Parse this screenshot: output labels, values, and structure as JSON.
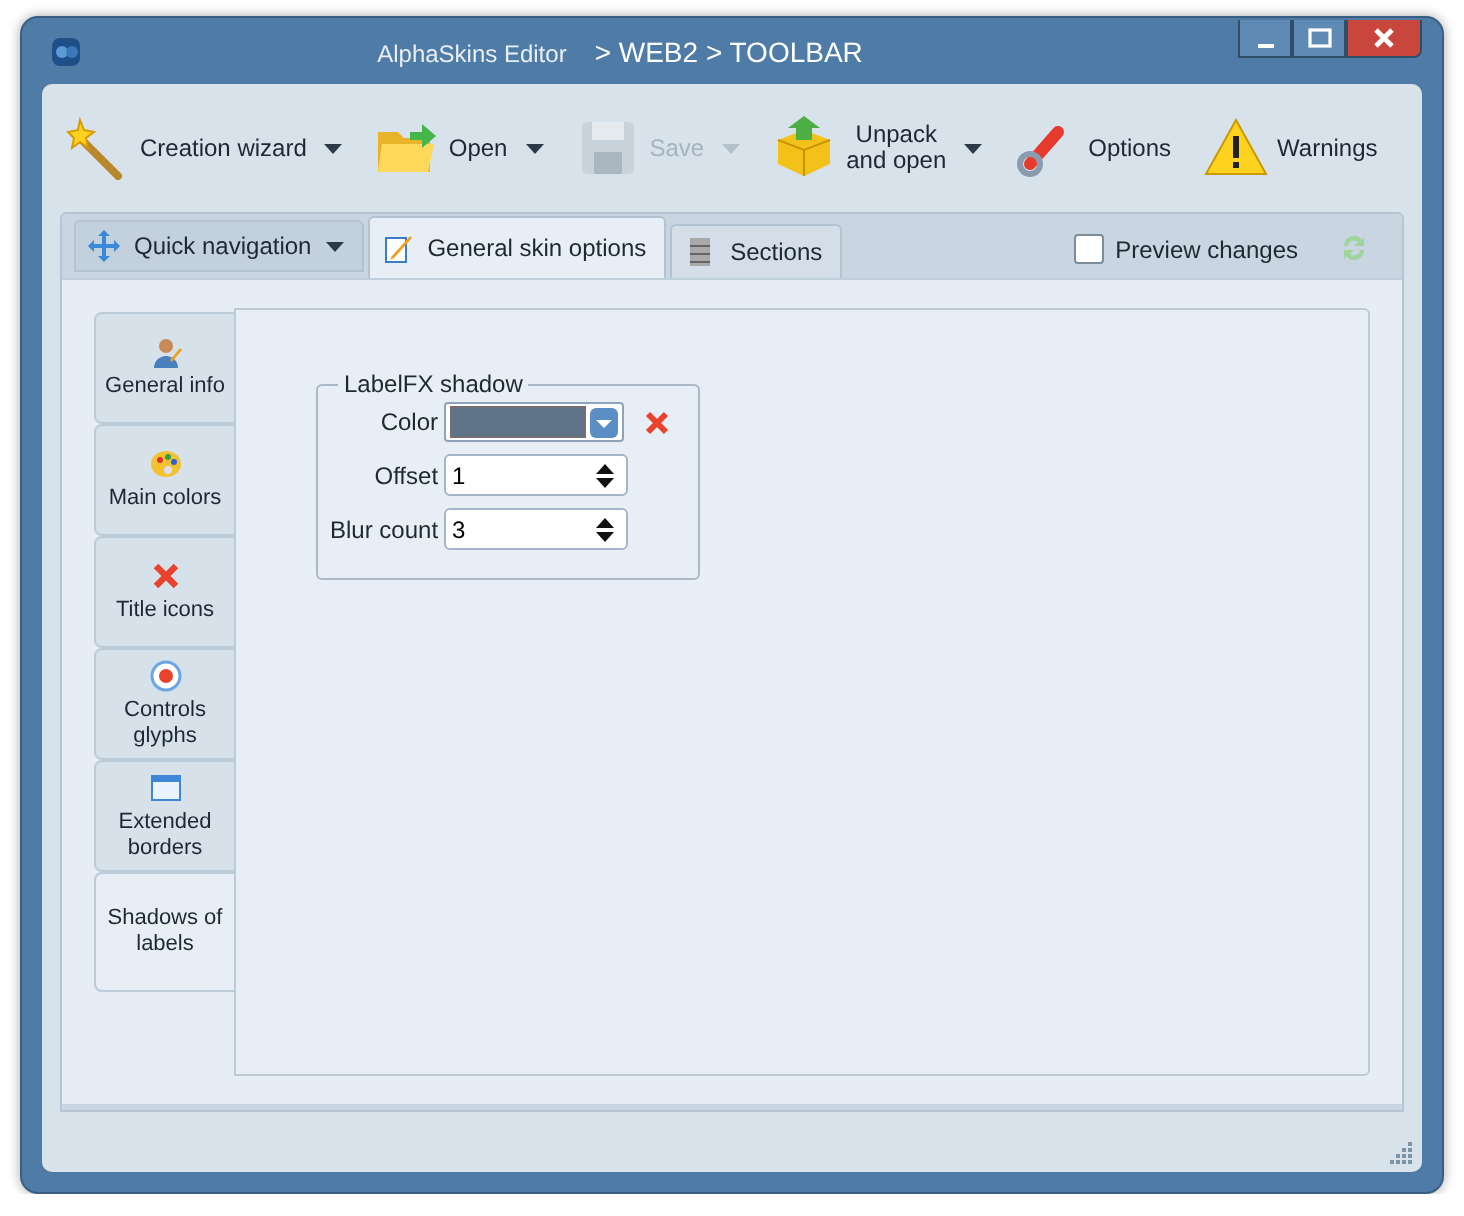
{
  "window": {
    "app": "AlphaSkins Editor",
    "path": "> WEB2 > TOOLBAR"
  },
  "toolbar": [
    {
      "label": "Creation wizard",
      "dropdown": true,
      "disabled": false
    },
    {
      "label": "Open",
      "dropdown": true,
      "disabled": false
    },
    {
      "label": "Save",
      "dropdown": true,
      "disabled": true
    },
    {
      "label": "Unpack\nand open",
      "dropdown": true,
      "disabled": false
    },
    {
      "label": "Options",
      "dropdown": false,
      "disabled": false
    },
    {
      "label": "Warnings",
      "dropdown": false,
      "disabled": false
    }
  ],
  "tabs": [
    {
      "label": "Quick navigation",
      "kind": "dropdown",
      "selected": false
    },
    {
      "label": "General  skin options",
      "kind": "tab",
      "selected": true
    },
    {
      "label": "Sections",
      "kind": "tab",
      "selected": false
    }
  ],
  "preview": {
    "label": "Preview changes",
    "checked": false
  },
  "side_tabs": [
    {
      "label": "General info",
      "selected": false
    },
    {
      "label": "Main colors",
      "selected": false
    },
    {
      "label": "Title icons",
      "selected": false
    },
    {
      "label": "Controls glyphs",
      "selected": false
    },
    {
      "label": "Extended borders",
      "selected": false
    },
    {
      "label": "Shadows of labels",
      "selected": true
    }
  ],
  "group": {
    "title": "LabelFX shadow",
    "fields": [
      {
        "label": "Color",
        "kind": "color",
        "color": "#5f7488"
      },
      {
        "label": "Offset",
        "kind": "spin",
        "value": "1"
      },
      {
        "label": "Blur count",
        "kind": "spin",
        "value": "3"
      }
    ]
  }
}
